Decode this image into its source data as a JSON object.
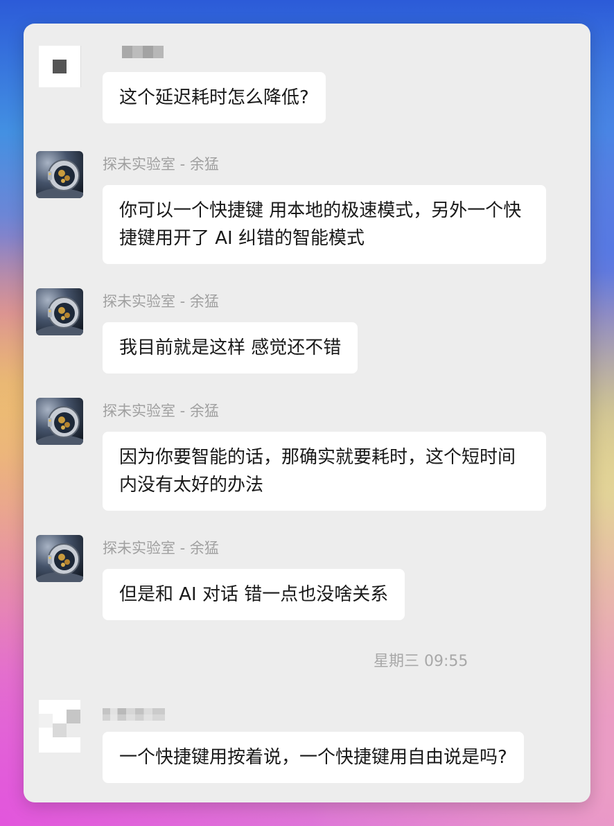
{
  "colors": {
    "panel_background": "#ededed",
    "bubble_background": "#ffffff",
    "message_text": "#191919",
    "sender_text": "#a0a0a0",
    "timestamp_text": "#a8a8a8"
  },
  "messages": [
    {
      "avatar_icon": "pixelated-avatar",
      "text": "这个延迟耗时怎么降低?"
    },
    {
      "avatar_icon": "astronaut-avatar",
      "sender": "探未实验室 - 余猛",
      "text": "你可以一个快捷键 用本地的极速模式，另外一个快捷键用开了 AI 纠错的智能模式"
    },
    {
      "avatar_icon": "astronaut-avatar",
      "sender": "探未实验室 - 余猛",
      "text": "我目前就是这样 感觉还不错"
    },
    {
      "avatar_icon": "astronaut-avatar",
      "sender": "探未实验室 - 余猛",
      "text": "因为你要智能的话，那确实就要耗时，这个短时间内没有太好的办法"
    },
    {
      "avatar_icon": "astronaut-avatar",
      "sender": "探未实验室 - 余猛",
      "text": "但是和 AI 对话 错一点也没啥关系"
    },
    {
      "avatar_icon": "pixelated-avatar",
      "text": "一个快捷键用按着说，一个快捷键用自由说是吗?"
    }
  ],
  "timestamp": "星期三 09:55"
}
